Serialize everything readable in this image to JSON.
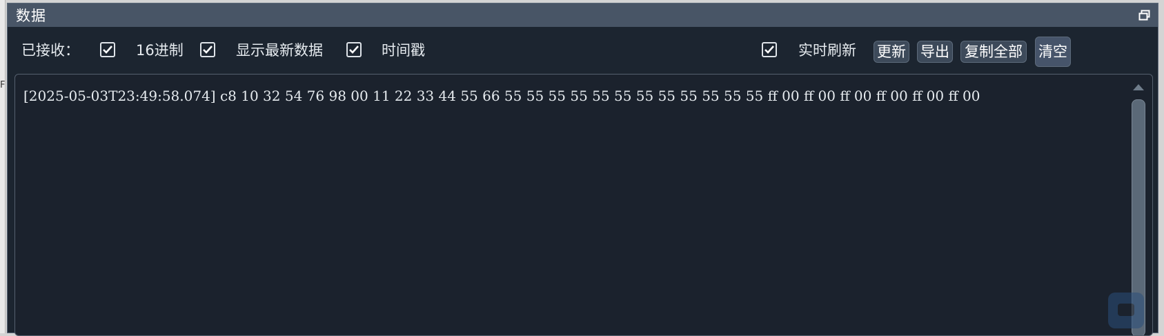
{
  "left_strip": {
    "mark": "F"
  },
  "panel": {
    "title": "数据"
  },
  "toolbar": {
    "received_label": "已接收：",
    "hex_label": "16进制",
    "hex_checked": true,
    "latest_label": "显示最新数据",
    "latest_checked": true,
    "timestamp_label": "时间戳",
    "timestamp_checked": true,
    "realtime_label": "实时刷新",
    "realtime_checked": true,
    "update_label": "更新",
    "export_label": "导出",
    "copy_all_label": "复制全部",
    "clear_label": "清空"
  },
  "log": {
    "lines": [
      "[2025-05-03T23:49:58.074] c8 10 32 54 76 98 00 11 22 33 44 55 66 55 55 55 55 55 55 55 55 55 55 55 55 ff 00 ff 00 ff 00 ff 00 ff 00 ff 00"
    ]
  },
  "colors": {
    "panel_bg": "#1c2530",
    "title_bar": "#485566",
    "button_bg": "#3d4a5a",
    "text": "#e6ebef"
  }
}
